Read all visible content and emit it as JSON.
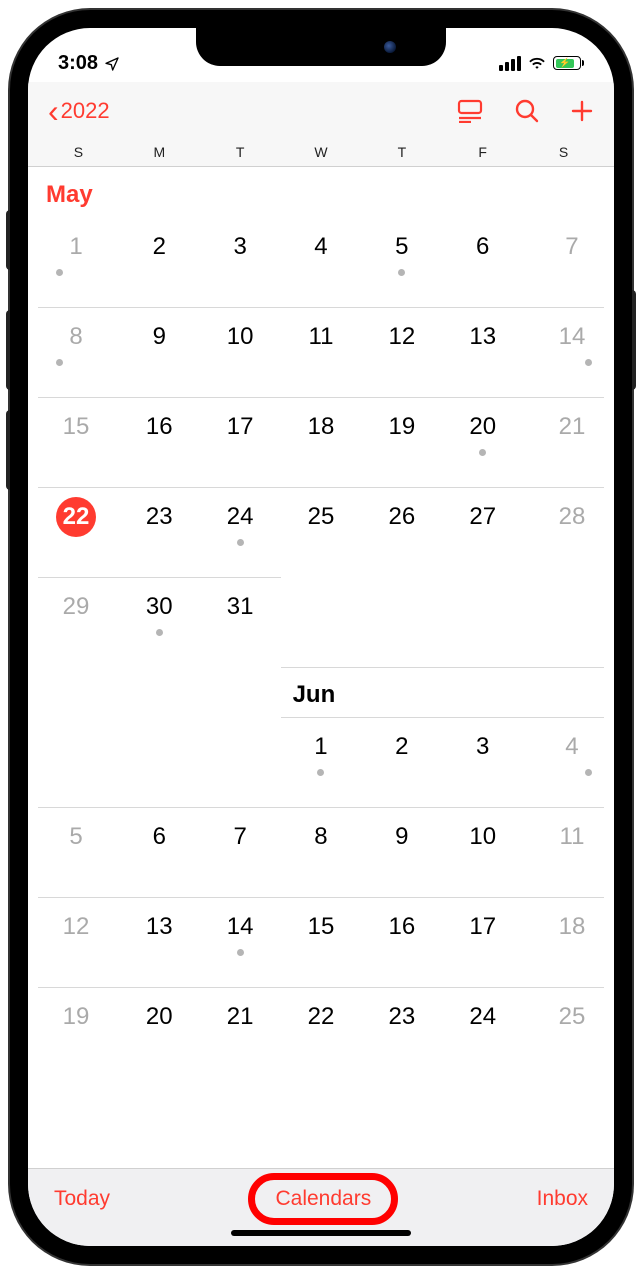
{
  "status": {
    "time": "3:08"
  },
  "nav": {
    "back_year": "2022"
  },
  "weekdays": [
    "S",
    "M",
    "T",
    "W",
    "T",
    "F",
    "S"
  ],
  "months": {
    "may": {
      "label": "May",
      "weeks": [
        [
          {
            "n": "1",
            "i": true,
            "d": true
          },
          {
            "n": "2",
            "d": false
          },
          {
            "n": "3",
            "d": false
          },
          {
            "n": "4",
            "d": false
          },
          {
            "n": "5",
            "d": true
          },
          {
            "n": "6",
            "d": false
          },
          {
            "n": "7",
            "i": true,
            "d": false
          }
        ],
        [
          {
            "n": "8",
            "i": true,
            "d": true
          },
          {
            "n": "9"
          },
          {
            "n": "10"
          },
          {
            "n": "11"
          },
          {
            "n": "12"
          },
          {
            "n": "13"
          },
          {
            "n": "14",
            "i": true,
            "d": true
          }
        ],
        [
          {
            "n": "15",
            "i": true
          },
          {
            "n": "16"
          },
          {
            "n": "17"
          },
          {
            "n": "18"
          },
          {
            "n": "19"
          },
          {
            "n": "20",
            "d": true
          },
          {
            "n": "21",
            "i": true
          }
        ],
        [
          {
            "n": "22",
            "i": false,
            "today": true
          },
          {
            "n": "23"
          },
          {
            "n": "24",
            "d": true
          },
          {
            "n": "25"
          },
          {
            "n": "26"
          },
          {
            "n": "27"
          },
          {
            "n": "28",
            "i": true
          }
        ],
        [
          {
            "n": "29",
            "i": true
          },
          {
            "n": "30",
            "d": true
          },
          {
            "n": "31"
          }
        ]
      ]
    },
    "jun": {
      "label": "Jun",
      "weeks": [
        [
          null,
          null,
          null,
          {
            "n": "1",
            "d": true
          },
          {
            "n": "2"
          },
          {
            "n": "3"
          },
          {
            "n": "4",
            "i": true,
            "d": true
          }
        ],
        [
          {
            "n": "5",
            "i": true
          },
          {
            "n": "6"
          },
          {
            "n": "7"
          },
          {
            "n": "8"
          },
          {
            "n": "9"
          },
          {
            "n": "10"
          },
          {
            "n": "11",
            "i": true
          }
        ],
        [
          {
            "n": "12",
            "i": true
          },
          {
            "n": "13"
          },
          {
            "n": "14",
            "d": true
          },
          {
            "n": "15"
          },
          {
            "n": "16"
          },
          {
            "n": "17"
          },
          {
            "n": "18",
            "i": true
          }
        ],
        [
          {
            "n": "19",
            "i": true,
            "d": true
          },
          {
            "n": "20",
            "d": true
          },
          {
            "n": "21"
          },
          {
            "n": "22"
          },
          {
            "n": "23"
          },
          {
            "n": "24"
          },
          {
            "n": "25",
            "i": true
          }
        ]
      ]
    }
  },
  "toolbar": {
    "today": "Today",
    "calendars": "Calendars",
    "inbox": "Inbox"
  }
}
